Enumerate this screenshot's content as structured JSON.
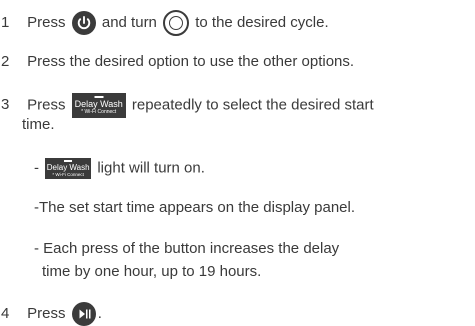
{
  "steps": [
    {
      "number": "1",
      "text_before_power": "Press",
      "text_middle": "and turn",
      "text_after_dial": "to the desired cycle."
    },
    {
      "number": "2",
      "text": "Press the desired option to use the other options."
    },
    {
      "number": "3",
      "text_before_button": "Press",
      "text_after_button": "repeatedly to select the desired start",
      "text_wrap": "time.",
      "sub_items": {
        "light": {
          "dash": "-",
          "text": "light will turn on."
        },
        "display": "-The set start time appears on the display panel.",
        "press_line1": "- Each press of the button increases the delay",
        "press_line2": "time by one hour, up to 19 hours."
      }
    },
    {
      "number": "4",
      "text_before_icon": "Press",
      "text_after_icon": "."
    }
  ],
  "delay_button": {
    "label": "Delay Wash",
    "sublabel": "* Wi-Fi Connect"
  },
  "icons": {
    "power": "power-icon",
    "dial": "cycle-dial-icon",
    "start_pause": "start-pause-icon",
    "color": "#3b3b3b"
  }
}
